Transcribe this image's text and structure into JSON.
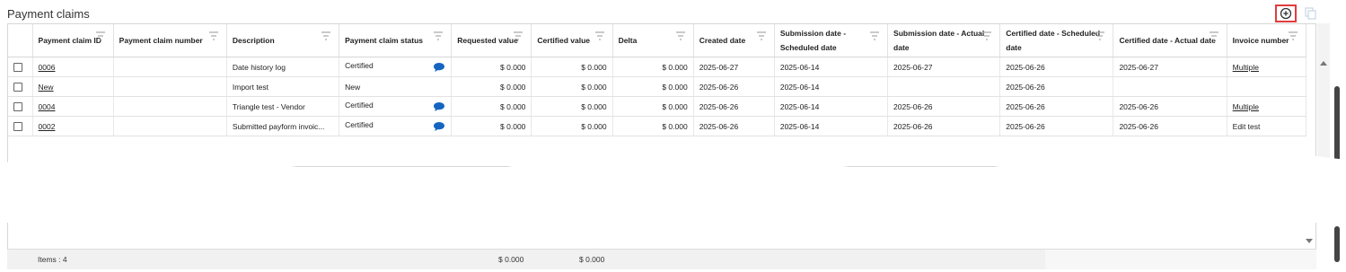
{
  "section": {
    "title": "Payment claims",
    "add_icon": "add-circle-icon",
    "copy_icon": "copy-icon"
  },
  "columns": [
    {
      "label": "Payment claim ID"
    },
    {
      "label": "Payment claim number"
    },
    {
      "label": "Description"
    },
    {
      "label": "Payment claim status"
    },
    {
      "label": "Requested value"
    },
    {
      "label": "Certified value"
    },
    {
      "label": "Delta"
    },
    {
      "label": "Created date"
    },
    {
      "label": "Submission date - Scheduled date"
    },
    {
      "label": "Submission date - Actual date"
    },
    {
      "label": "Certified date - Scheduled date"
    },
    {
      "label": "Certified date - Actual date"
    },
    {
      "label": "Invoice number"
    }
  ],
  "rows": [
    {
      "id": "0006",
      "number": "",
      "description": "Date history log",
      "status": "Certified",
      "has_comment": true,
      "requested": "$ 0.000",
      "certified": "$ 0.000",
      "delta": "$ 0.000",
      "created": "2025-06-27",
      "sub_sched": "2025-06-14",
      "sub_actual": "2025-06-27",
      "cert_sched": "2025-06-26",
      "cert_actual": "2025-06-27",
      "invoice": "Multiple",
      "invoice_link": true
    },
    {
      "id": "New",
      "number": "",
      "description": "Import test",
      "status": "New",
      "has_comment": false,
      "requested": "$ 0.000",
      "certified": "$ 0.000",
      "delta": "$ 0.000",
      "created": "2025-06-26",
      "sub_sched": "2025-06-14",
      "sub_actual": "",
      "cert_sched": "2025-06-26",
      "cert_actual": "",
      "invoice": "",
      "invoice_link": false
    },
    {
      "id": "0004",
      "number": "",
      "description": "Triangle test - Vendor",
      "status": "Certified",
      "has_comment": true,
      "requested": "$ 0.000",
      "certified": "$ 0.000",
      "delta": "$ 0.000",
      "created": "2025-06-26",
      "sub_sched": "2025-06-14",
      "sub_actual": "2025-06-26",
      "cert_sched": "2025-06-26",
      "cert_actual": "2025-06-26",
      "invoice": "Multiple",
      "invoice_link": true
    },
    {
      "id": "0002",
      "number": "",
      "description": "Submitted payform invoic...",
      "status": "Certified",
      "has_comment": true,
      "requested": "$ 0.000",
      "certified": "$ 0.000",
      "delta": "$ 0.000",
      "created": "2025-06-26",
      "sub_sched": "2025-06-14",
      "sub_actual": "2025-06-26",
      "cert_sched": "2025-06-26",
      "cert_actual": "2025-06-26",
      "invoice": "Edit test",
      "invoice_link": false
    }
  ],
  "footer": {
    "items_label": "Items : 4",
    "requested_total": "$ 0.000",
    "certified_total": "$ 0.000"
  },
  "colors": {
    "highlight_border": "#e23c3c",
    "comment_icon": "#1565c0"
  }
}
